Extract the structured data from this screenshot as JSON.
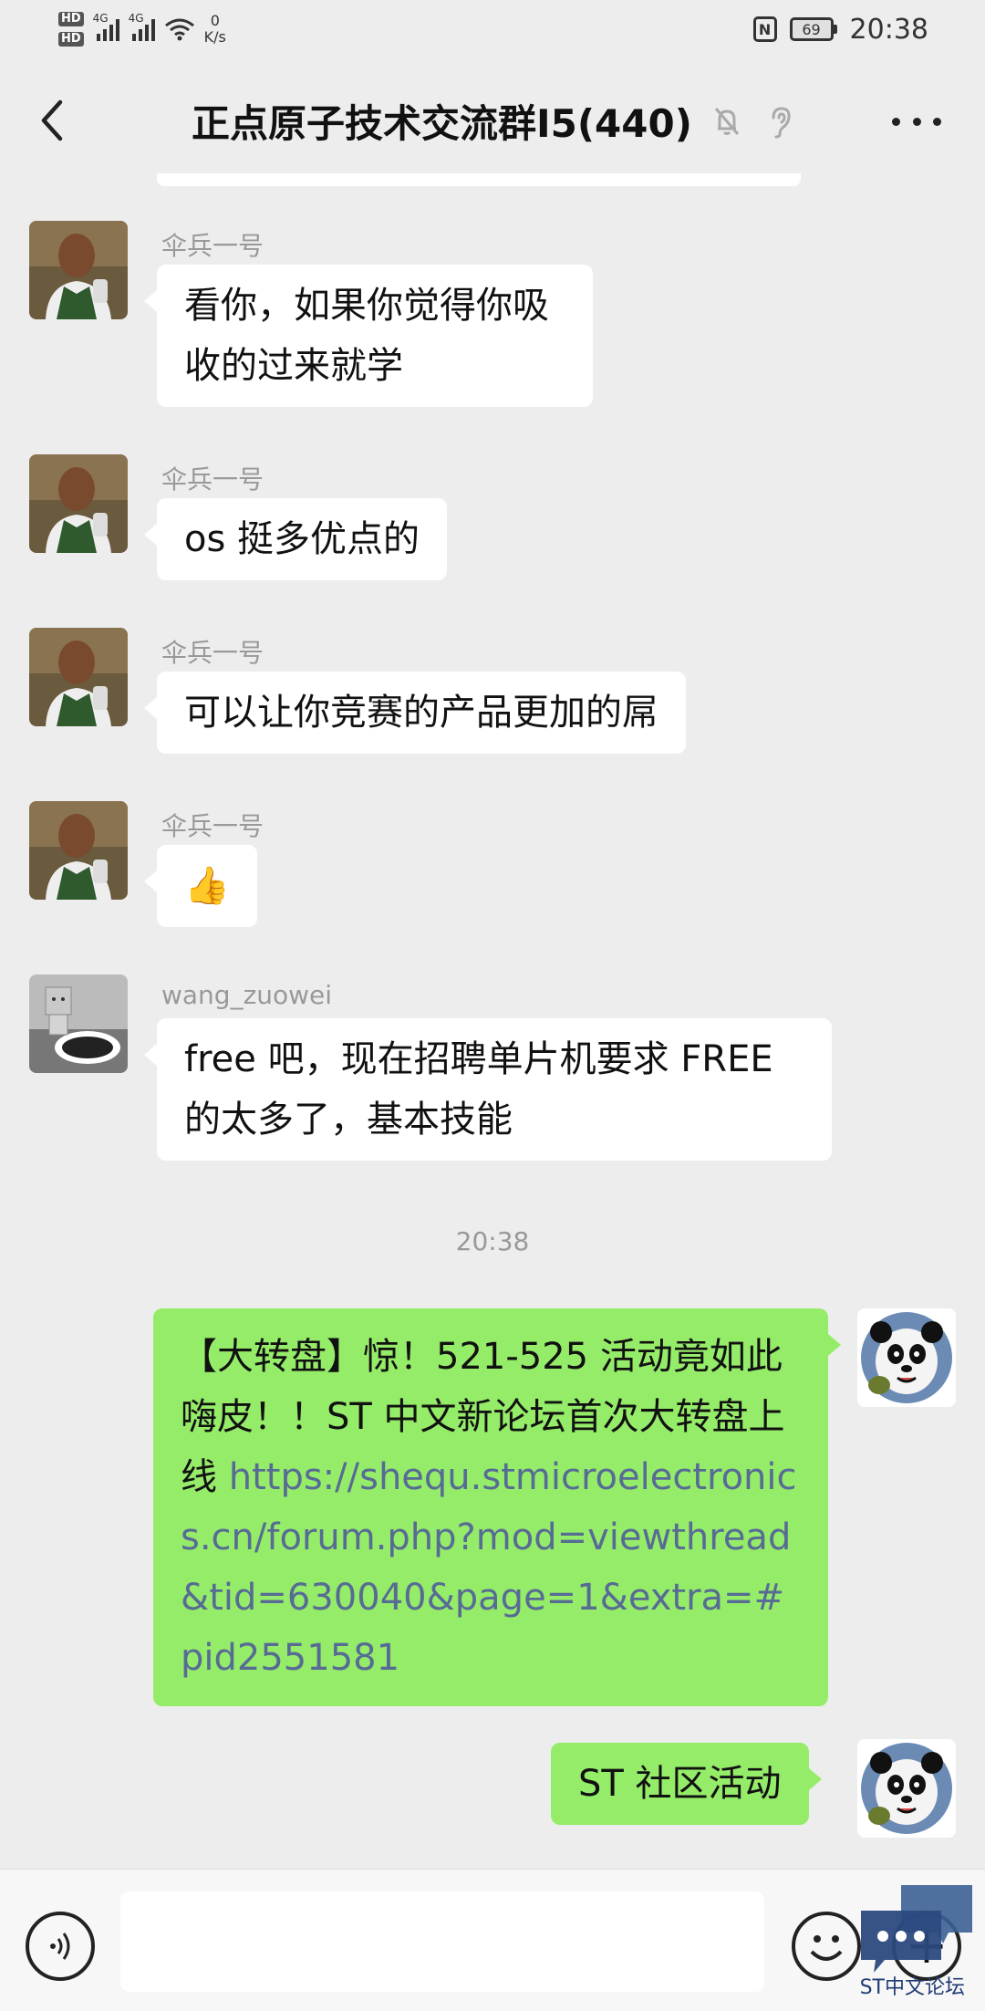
{
  "status_bar": {
    "hd1": "HD",
    "hd2": "HD",
    "net1": "4G",
    "net2": "4G",
    "speed_value": "0",
    "speed_unit": "K/s",
    "nfc": "N",
    "battery": "69",
    "time": "20:38"
  },
  "header": {
    "title": "正点原子技术交流群I5(440)"
  },
  "messages": [
    {
      "sender": "伞兵一号",
      "text": "看你，如果你觉得你吸收的过来就学"
    },
    {
      "sender": "伞兵一号",
      "text": "os 挺多优点的"
    },
    {
      "sender": "伞兵一号",
      "text": "可以让你竞赛的产品更加的屌"
    },
    {
      "sender": "伞兵一号",
      "text": "👍"
    },
    {
      "sender": "wang_zuowei",
      "text": "free 吧，现在招聘单片机要求 FREE 的太多了，基本技能"
    }
  ],
  "timestamp": "20:38",
  "own_messages": [
    {
      "text_prefix": "【大转盘】惊！521-525 活动竟如此嗨皮！！ST 中文新论坛首次大转盘上线 ",
      "link": "https://shequ.stmicroelectronics.cn/forum.php?mod=viewthread&tid=630040&page=1&extra=#pid2551581"
    },
    {
      "text": "ST 社区活动"
    }
  ],
  "watermark": "ST中文论坛",
  "colors": {
    "background": "#ededed",
    "own_bubble": "#95ec69",
    "other_bubble": "#ffffff",
    "link": "#576b95"
  }
}
